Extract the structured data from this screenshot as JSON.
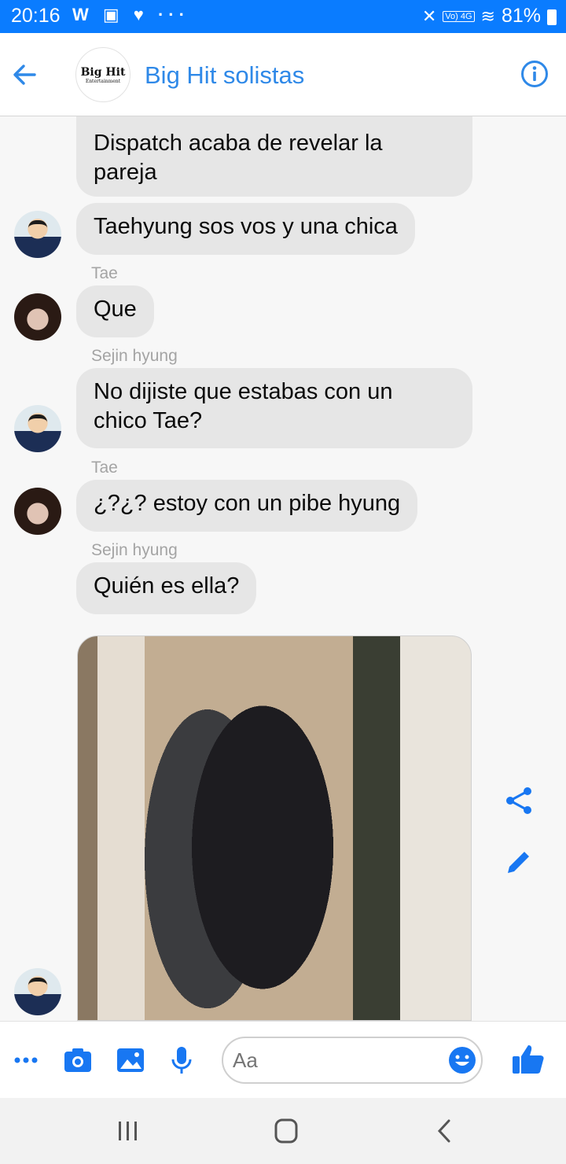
{
  "status_bar": {
    "time": "20:16",
    "left_icons": "W ▣ ♥ ···",
    "network_tag": "Vo) 4G",
    "battery": "81%"
  },
  "header": {
    "title": "Big Hit solistas",
    "logo_line1": "Big Hit",
    "logo_line2": "Entertainment",
    "icons": [
      "back-arrow-icon",
      "info-icon"
    ],
    "accent_color": "#0a7cff"
  },
  "messages": [
    {
      "sender": "",
      "text": "Dispatch acaba de revelar la\npareja"
    },
    {
      "sender": "",
      "text": "Taehyung sos vos y una chica"
    },
    {
      "sender": "Tae",
      "text": "Que"
    },
    {
      "sender": "Sejin hyung",
      "text": "No dijiste que estabas con un\nchico Tae?"
    },
    {
      "sender": "Tae",
      "text": "¿?¿? estoy con un pibe hyung"
    },
    {
      "sender": "Sejin hyung",
      "text": "Quién es ella?"
    }
  ],
  "photo_message": {
    "alt_icon": "photo-message"
  },
  "side_actions": [
    "share-icon",
    "edit-pencil-icon"
  ],
  "composer": {
    "placeholder": "Aa",
    "icons": [
      "more-icon",
      "camera-icon",
      "gallery-icon",
      "microphone-icon",
      "emoji-icon",
      "thumbs-up-icon"
    ]
  },
  "nav_bar": {
    "icons": [
      "recent-apps-icon",
      "home-icon",
      "back-icon"
    ]
  }
}
